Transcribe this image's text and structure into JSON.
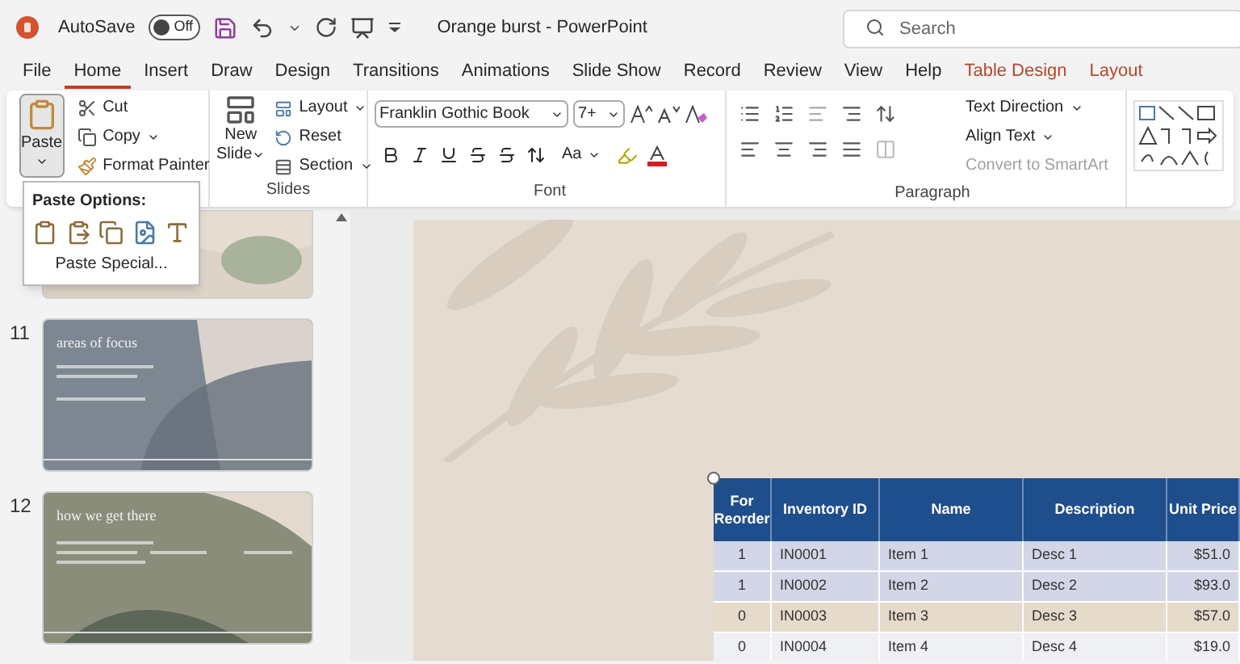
{
  "title_bar": {
    "autosave": {
      "label": "AutoSave",
      "on": false,
      "state_text": "Off"
    },
    "document_title": "Orange burst",
    "separator": "-",
    "app_name": "PowerPoint",
    "search": {
      "placeholder": "Search"
    }
  },
  "tabs": [
    {
      "label": "File",
      "selected": false,
      "contextual": false
    },
    {
      "label": "Home",
      "selected": true,
      "contextual": false
    },
    {
      "label": "Insert",
      "selected": false,
      "contextual": false
    },
    {
      "label": "Draw",
      "selected": false,
      "contextual": false
    },
    {
      "label": "Design",
      "selected": false,
      "contextual": false
    },
    {
      "label": "Transitions",
      "selected": false,
      "contextual": false
    },
    {
      "label": "Animations",
      "selected": false,
      "contextual": false
    },
    {
      "label": "Slide Show",
      "selected": false,
      "contextual": false
    },
    {
      "label": "Record",
      "selected": false,
      "contextual": false
    },
    {
      "label": "Review",
      "selected": false,
      "contextual": false
    },
    {
      "label": "View",
      "selected": false,
      "contextual": false
    },
    {
      "label": "Help",
      "selected": false,
      "contextual": false
    },
    {
      "label": "Table Design",
      "selected": false,
      "contextual": true
    },
    {
      "label": "Layout",
      "selected": false,
      "contextual": true
    }
  ],
  "ribbon": {
    "clipboard": {
      "paste": "Paste",
      "cut": "Cut",
      "copy": "Copy",
      "format_painter": "Format Painter"
    },
    "slides": {
      "label": "Slides",
      "new_slide": [
        "New",
        "Slide"
      ],
      "layout": "Layout",
      "reset": "Reset",
      "section": "Section"
    },
    "font": {
      "label": "Font",
      "font_name": "Franklin Gothic Book",
      "font_size": "7+",
      "change_case": "Aa"
    },
    "paragraph": {
      "label": "Paragraph",
      "text_direction": "Text Direction",
      "align_text": "Align Text",
      "convert_smartart": {
        "label": "Convert to SmartArt",
        "disabled": true
      }
    }
  },
  "paste_menu": {
    "title": "Paste Options:",
    "special": "Paste Special..."
  },
  "thumbnails": [
    {
      "number": "11",
      "title": "areas of focus"
    },
    {
      "number": "12",
      "title": "how we get there"
    }
  ],
  "table": {
    "columns": [
      "For Reorder",
      "Inventory ID",
      "Name",
      "Description",
      "Unit Price"
    ],
    "rows": [
      {
        "color": "#d3d6e6",
        "cells": [
          "1",
          "IN0001",
          "Item 1",
          "Desc 1",
          "$51.0"
        ]
      },
      {
        "color": "#d3d6e6",
        "cells": [
          "1",
          "IN0002",
          "Item 2",
          "Desc 2",
          "$93.0"
        ]
      },
      {
        "color": "#e6dacb",
        "cells": [
          "0",
          "IN0003",
          "Item 3",
          "Desc 3",
          "$57.0"
        ]
      },
      {
        "color": "#eef0f3",
        "cells": [
          "0",
          "IN0004",
          "Item 4",
          "Desc 4",
          "$19.0"
        ]
      }
    ]
  }
}
